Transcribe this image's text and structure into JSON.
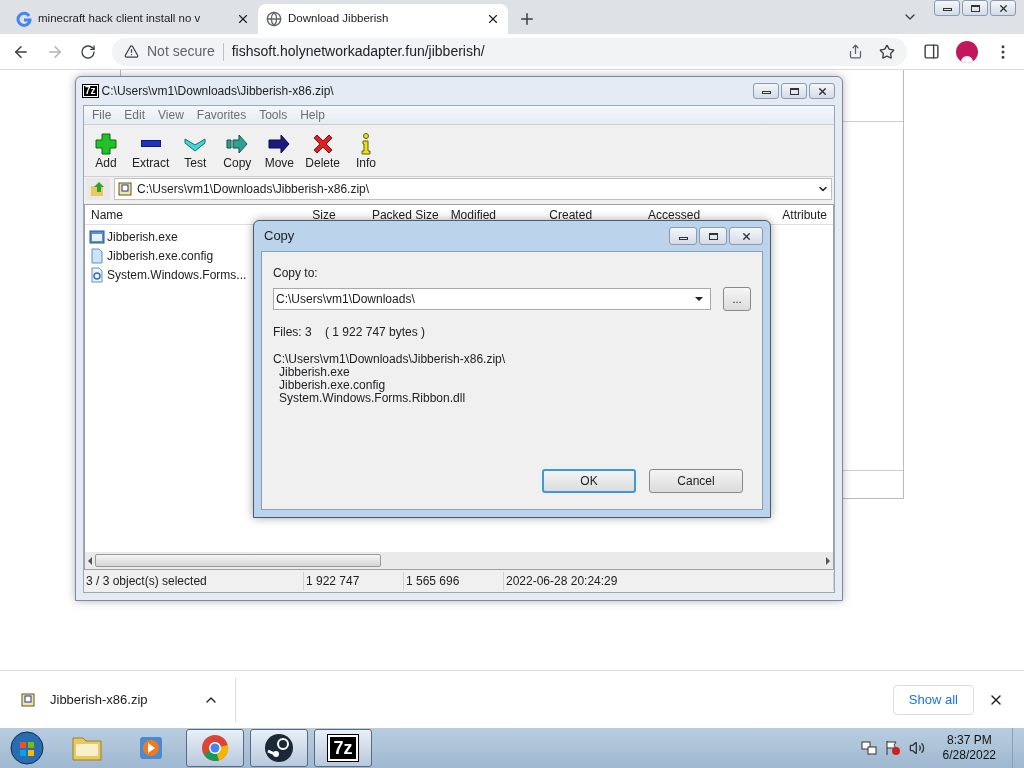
{
  "browser": {
    "tabs": [
      {
        "title": "minecraft hack client install no v",
        "selected": false,
        "kind": "search"
      },
      {
        "title": "Download Jibberish",
        "selected": true,
        "kind": "site"
      }
    ],
    "security": "Not secure",
    "url": "fishsoft.holynetworkadapter.fun/jibberish/"
  },
  "archiver": {
    "logo": "7z",
    "title": "C:\\Users\\vm1\\Downloads\\Jibberish-x86.zip\\",
    "menu": [
      "File",
      "Edit",
      "View",
      "Favorites",
      "Tools",
      "Help"
    ],
    "toolbar": [
      {
        "label": "Add",
        "kind": "add"
      },
      {
        "label": "Extract",
        "kind": "extract"
      },
      {
        "label": "Test",
        "kind": "test"
      },
      {
        "label": "Copy",
        "kind": "copy"
      },
      {
        "label": "Move",
        "kind": "move"
      },
      {
        "label": "Delete",
        "kind": "delete"
      },
      {
        "label": "Info",
        "kind": "info"
      }
    ],
    "path": "C:\\Users\\vm1\\Downloads\\Jibberish-x86.zip\\",
    "columns": [
      "Name",
      "Size",
      "Packed Size",
      "Modified",
      "Created",
      "Accessed",
      "Attribute"
    ],
    "files": [
      {
        "name": "Jibberish.exe",
        "kind": "exe"
      },
      {
        "name": "Jibberish.exe.config",
        "kind": "config"
      },
      {
        "name": "System.Windows.Forms...",
        "kind": "dll"
      }
    ],
    "status": [
      "3 / 3 object(s) selected",
      "1 922 747",
      "1 565 696",
      "2022-06-28 20:24:29"
    ]
  },
  "dialog": {
    "title": "Copy",
    "label": "Copy to:",
    "value": "C:\\Users\\vm1\\Downloads\\",
    "browse": "...",
    "files_info": "Files: 3    ( 1 922 747 bytes )",
    "source": "C:\\Users\\vm1\\Downloads\\Jibberish-x86.zip\\",
    "items": [
      "Jibberish.exe",
      "Jibberish.exe.config",
      "System.Windows.Forms.Ribbon.dll"
    ],
    "buttons": [
      {
        "label": "OK",
        "focused": true
      },
      {
        "label": "Cancel",
        "focused": false
      }
    ]
  },
  "download": {
    "file": "Jibberish-x86.zip",
    "show_all": "Show all"
  },
  "taskbar": {
    "apps": [
      {
        "kind": "folder",
        "running": false
      },
      {
        "kind": "media",
        "running": false
      },
      {
        "kind": "chrome",
        "running": true
      },
      {
        "kind": "steam",
        "running": true
      },
      {
        "kind": "archiver",
        "running": true
      }
    ],
    "logo": "7z",
    "time": "8:37 PM",
    "date": "6/28/2022"
  }
}
